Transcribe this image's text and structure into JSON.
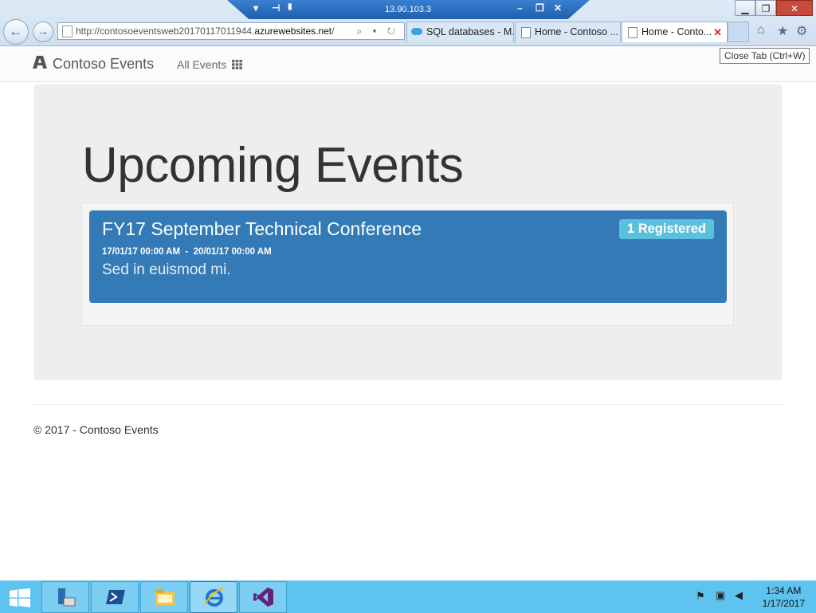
{
  "window": {
    "rdp_ip": "13.90.103.3",
    "controls": {
      "minimize": "▁",
      "restore": "❐",
      "close": "✕"
    }
  },
  "browser": {
    "back_icon": "back-arrow-icon",
    "forward_icon": "forward-arrow-icon",
    "address_prefix": "http://contosoeventsweb20170117011944.",
    "address_domain": "azurewebsites.net",
    "address_suffix": "/",
    "address_tools": "⌕ ▾ ↻",
    "tabs": [
      {
        "label": "SQL databases - M...",
        "icon": "cloud-icon",
        "active": false
      },
      {
        "label": "Home - Contoso ...",
        "icon": "page-icon",
        "active": false
      },
      {
        "label": "Home - Conto...",
        "icon": "page-icon",
        "active": true,
        "close": "✕"
      }
    ],
    "right_icons": [
      "home-icon",
      "star-icon",
      "gear-icon"
    ],
    "tooltip": "Close Tab (Ctrl+W)"
  },
  "site": {
    "brand": "Contoso Events",
    "nav_all_events": "All Events",
    "heading": "Upcoming Events",
    "events": [
      {
        "title": "FY17 September Technical Conference",
        "start": "17/01/17 00:00 AM",
        "end": "20/01/17 00:00 AM",
        "separator": "-",
        "description": "Sed in euismod mi.",
        "badge": "1 Registered"
      }
    ],
    "footer": "© 2017 - Contoso Events"
  },
  "taskbar": {
    "apps": [
      "start-button",
      "server-manager-icon",
      "powershell-icon",
      "file-explorer-icon",
      "internet-explorer-icon",
      "visual-studio-icon"
    ],
    "time": "1:34 AM",
    "date": "1/17/2017"
  },
  "colors": {
    "event_bg": "#337ab7",
    "badge_bg": "#5bc0de",
    "jumbotron_bg": "#eeeeee",
    "taskbar_bg": "#5fc3f0"
  }
}
